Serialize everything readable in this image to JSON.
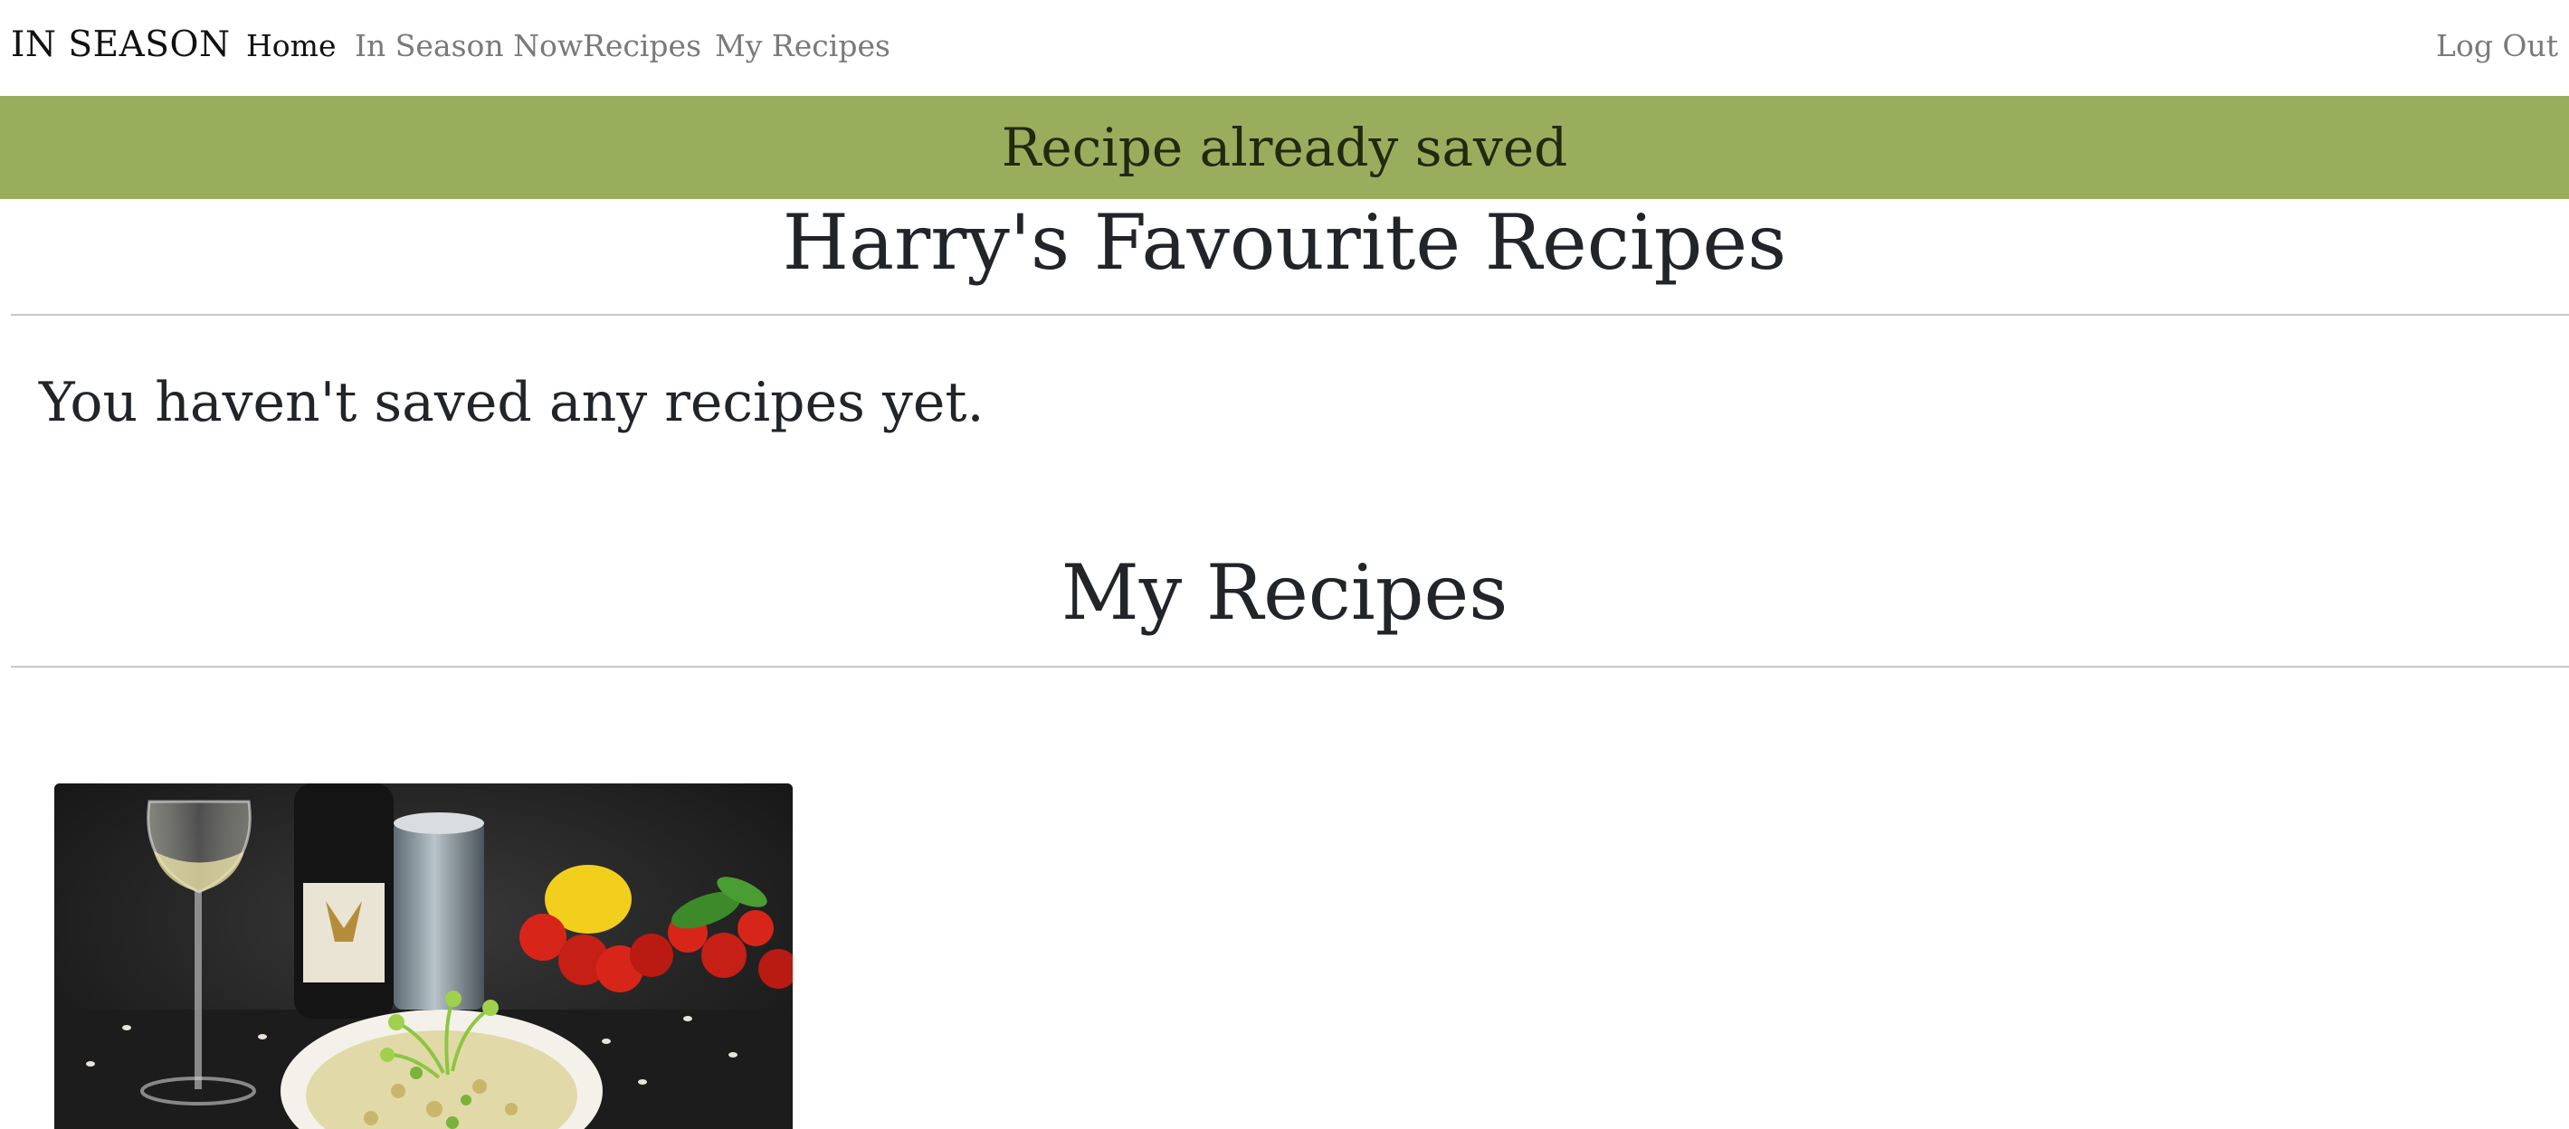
{
  "navbar": {
    "brand": "IN SEASON",
    "links": [
      {
        "label": "Home",
        "active": true
      },
      {
        "label": "In Season Now",
        "active": false
      },
      {
        "label": "Recipes",
        "active": false
      },
      {
        "label": "My Recipes",
        "active": false
      }
    ],
    "logout_label": "Log Out"
  },
  "alert": {
    "message": "Recipe already saved",
    "color": "#99ae5c"
  },
  "favourites": {
    "title": "Harry's Favourite Recipes",
    "empty_message": "You haven't saved any recipes yet."
  },
  "my_recipes": {
    "title": "My Recipes",
    "cards": [
      {
        "image": "risotto-with-wine-photo"
      }
    ]
  }
}
